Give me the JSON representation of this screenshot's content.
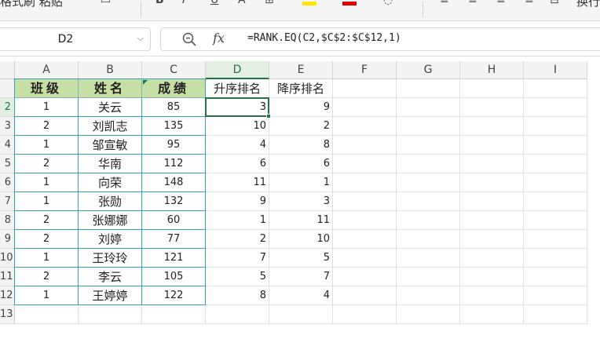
{
  "ribbon": {
    "left_text": "格式刷 粘贴",
    "right_text": "换行"
  },
  "name_box": {
    "value": "D2"
  },
  "formula": {
    "text": "=RANK.EQ(C2,$C$2:$C$12,1)"
  },
  "columns": [
    "A",
    "B",
    "C",
    "D",
    "E",
    "F",
    "G",
    "H",
    "I"
  ],
  "active_column": "D",
  "row_numbers": [
    "2",
    "3",
    "4",
    "5",
    "6",
    "7",
    "8",
    "9",
    "10",
    "11",
    "12",
    "13"
  ],
  "headers": {
    "class": "班级",
    "name": "姓名",
    "score": "成绩",
    "asc_rank": "升序排名",
    "desc_rank": "降序排名"
  },
  "rows": [
    {
      "class": "1",
      "name": "关云",
      "score": "85",
      "asc": "3",
      "desc": "9"
    },
    {
      "class": "2",
      "name": "刘凯志",
      "score": "135",
      "asc": "10",
      "desc": "2"
    },
    {
      "class": "1",
      "name": "邹宣敏",
      "score": "95",
      "asc": "4",
      "desc": "8"
    },
    {
      "class": "2",
      "name": "华南",
      "score": "112",
      "asc": "6",
      "desc": "6"
    },
    {
      "class": "1",
      "name": "向荣",
      "score": "148",
      "asc": "11",
      "desc": "1"
    },
    {
      "class": "1",
      "name": "张勋",
      "score": "132",
      "asc": "9",
      "desc": "3"
    },
    {
      "class": "2",
      "name": "张娜娜",
      "score": "60",
      "asc": "1",
      "desc": "11"
    },
    {
      "class": "2",
      "name": "刘婷",
      "score": "77",
      "asc": "2",
      "desc": "10"
    },
    {
      "class": "1",
      "name": "王玲玲",
      "score": "121",
      "asc": "7",
      "desc": "5"
    },
    {
      "class": "2",
      "name": "李云",
      "score": "105",
      "asc": "5",
      "desc": "7"
    },
    {
      "class": "1",
      "name": "王婷婷",
      "score": "122",
      "asc": "8",
      "desc": "4"
    }
  ],
  "colors": {
    "header_fill": "#c5dfa4",
    "table_border": "#39a3b5",
    "selection": "#217346"
  },
  "icons": {
    "zoom": "zoom-formula-icon",
    "fx": "function-icon",
    "dropdown": "chevron-down-icon"
  }
}
